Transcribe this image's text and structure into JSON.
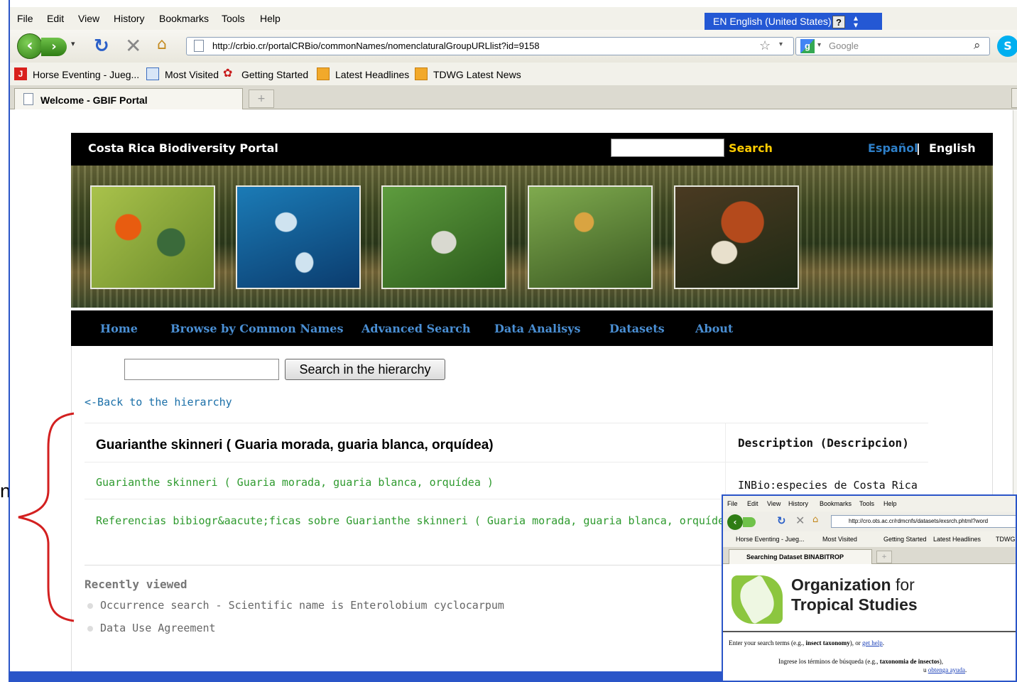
{
  "side_fragment": {
    "letter": "n"
  },
  "browser": {
    "menu": [
      "File",
      "Edit",
      "View",
      "History",
      "Bookmarks",
      "Tools",
      "Help"
    ],
    "language_bar": {
      "label": "EN English (United States)",
      "help": "?"
    },
    "url": "http://crbio.cr/portalCRBio/commonNames/nomenclaturalGroupURLlist?id=9158",
    "search_engine": "Google",
    "bookmarks": [
      "Horse Eventing - Jueg...",
      "Most Visited",
      "Getting Started",
      "Latest Headlines",
      "TDWG Latest News"
    ],
    "tab_title": "Welcome - GBIF Portal",
    "new_tab": "+"
  },
  "portal": {
    "title": "Costa Rica Biodiversity Portal",
    "search_label": "Search",
    "lang_es": "Español",
    "lang_sep": "|",
    "lang_en": "English",
    "nav": [
      "Home",
      "Browse by Common Names",
      "Advanced Search",
      "Data Analisys",
      "Datasets",
      "About"
    ]
  },
  "hierarchy": {
    "button": "Search in the hierarchy",
    "back_link": "<-Back to the hierarchy"
  },
  "results": {
    "title": "Guarianthe skinneri ( Guaria morada, guaria blanca, orquídea)",
    "desc_header": "Description (Descripcion)",
    "rows": [
      {
        "link": "Guarianthe skinneri ( Guaria morada, guaria blanca, orquídea )",
        "desc": "INBio:especies de Costa Rica"
      },
      {
        "link": "Referencias bibiogr&aacute;ficas sobre Guarianthe skinneri ( Guaria morada, guaria blanca, orquídea )",
        "desc": ""
      }
    ]
  },
  "recent": {
    "heading": "Recently viewed",
    "items": [
      "Occurrence search - Scientific name is Enterolobium cyclocarpum",
      "Data Use Agreement"
    ]
  },
  "inset": {
    "menu": [
      "File",
      "Edit",
      "View",
      "History",
      "Bookmarks",
      "Tools",
      "Help"
    ],
    "url": "http://cro.ots.ac.cr/rdmcnfs/datasets/exsrch.phtml?word",
    "bookmarks": [
      "Horse Eventing - Jueg...",
      "Most Visited",
      "Getting Started",
      "Latest Headlines",
      "TDWG L"
    ],
    "tab_title": "Searching Dataset BINABITROP",
    "org_bold": "Organization",
    "org_light": " for",
    "org_line2": "Tropical Studies",
    "enter_text_pre": "Enter your search terms (e.g., ",
    "enter_text_bold": "insect taxonomy",
    "enter_text_mid": "), or ",
    "enter_text_link": "get help",
    "enter_text_end": ".",
    "es_text_pre": "Ingrese los términos de búsqueda (e.g., ",
    "es_text_bold": "taxonomia de insectos",
    "es_text_end": "),",
    "es_text2_pre": "u ",
    "es_text2_link": "obtenga ayuda",
    "es_text2_end": "."
  },
  "colors": {
    "brace": "#d32020",
    "accent_blue": "#2a55c8",
    "link_green": "#2e9a2e",
    "nav_blue": "#4a8fd4"
  }
}
